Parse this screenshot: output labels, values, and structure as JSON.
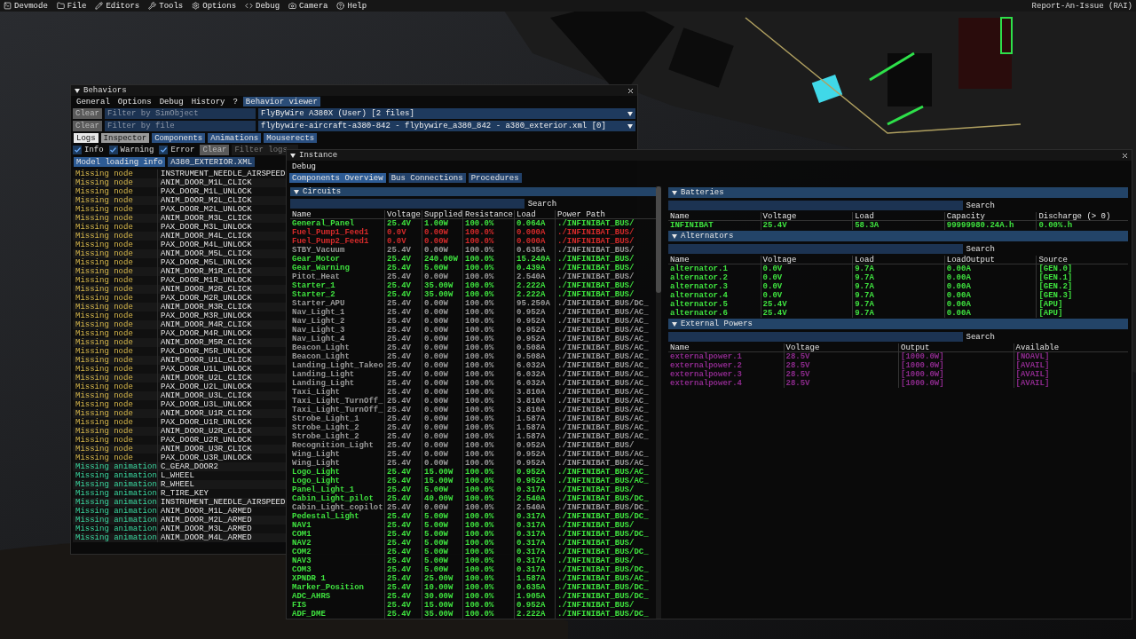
{
  "menu_bar": {
    "items": [
      {
        "label": "Devmode"
      },
      {
        "label": "File"
      },
      {
        "label": "Editors"
      },
      {
        "label": "Tools"
      },
      {
        "label": "Options"
      },
      {
        "label": "Debug"
      },
      {
        "label": "Camera"
      },
      {
        "label": "Help"
      }
    ],
    "right": "Report-An-Issue (RAI)"
  },
  "behaviors": {
    "title": "Behaviors",
    "tabs": [
      {
        "label": "General",
        "selected": false
      },
      {
        "label": "Options",
        "selected": false
      },
      {
        "label": "Debug",
        "selected": false
      },
      {
        "label": "History",
        "selected": false
      },
      {
        "label": "?",
        "selected": false
      },
      {
        "label": "Behavior viewer",
        "selected": true
      }
    ],
    "filters": [
      {
        "button": "Clear",
        "placeholder": "Filter by SimObject",
        "dropdown": "FlyByWire A380X (User) [2 files]"
      },
      {
        "button": "Clear",
        "placeholder": "Filter by file",
        "dropdown": "flybywire-aircraft-a380-842 - flybywire_a380_842 - a380_exterior.xml [0]"
      }
    ],
    "sub_tabs": [
      {
        "label": "Logs",
        "selected": true,
        "hovered": false
      },
      {
        "label": "Inspector",
        "selected": false,
        "hovered": true
      },
      {
        "label": "Components",
        "selected": false,
        "hovered": false
      },
      {
        "label": "Animations",
        "selected": false,
        "hovered": false
      },
      {
        "label": "Mouserects",
        "selected": false,
        "hovered": false
      }
    ],
    "log_filters": [
      {
        "label": "Info",
        "checked": true
      },
      {
        "label": "Warning",
        "checked": true
      },
      {
        "label": "Error",
        "checked": true
      }
    ],
    "clear_button": "Clear",
    "filter_placeholder": "Filter logs",
    "file_tabs": [
      {
        "label": "Model loading info",
        "selected": true
      },
      {
        "label": "A380_EXTERIOR.XML",
        "selected": false
      }
    ],
    "logs": [
      {
        "kind": "node",
        "type": "Missing node",
        "target": "INSTRUMENT_NEEDLE_AIRSPEED"
      },
      {
        "kind": "node",
        "type": "Missing node",
        "target": "ANIM_DOOR_M1L_CLICK"
      },
      {
        "kind": "node",
        "type": "Missing node",
        "target": "PAX_DOOR_M1L_UNLOCK"
      },
      {
        "kind": "node",
        "type": "Missing node",
        "target": "ANIM_DOOR_M2L_CLICK"
      },
      {
        "kind": "node",
        "type": "Missing node",
        "target": "PAX_DOOR_M2L_UNLOCK"
      },
      {
        "kind": "node",
        "type": "Missing node",
        "target": "ANIM_DOOR_M3L_CLICK"
      },
      {
        "kind": "node",
        "type": "Missing node",
        "target": "PAX_DOOR_M3L_UNLOCK"
      },
      {
        "kind": "node",
        "type": "Missing node",
        "target": "ANIM_DOOR_M4L_CLICK"
      },
      {
        "kind": "node",
        "type": "Missing node",
        "target": "PAX_DOOR_M4L_UNLOCK"
      },
      {
        "kind": "node",
        "type": "Missing node",
        "target": "ANIM_DOOR_M5L_CLICK"
      },
      {
        "kind": "node",
        "type": "Missing node",
        "target": "PAX_DOOR_M5L_UNLOCK"
      },
      {
        "kind": "node",
        "type": "Missing node",
        "target": "ANIM_DOOR_M1R_CLICK"
      },
      {
        "kind": "node",
        "type": "Missing node",
        "target": "PAX_DOOR_M1R_UNLOCK"
      },
      {
        "kind": "node",
        "type": "Missing node",
        "target": "ANIM_DOOR_M2R_CLICK"
      },
      {
        "kind": "node",
        "type": "Missing node",
        "target": "PAX_DOOR_M2R_UNLOCK"
      },
      {
        "kind": "node",
        "type": "Missing node",
        "target": "ANIM_DOOR_M3R_CLICK"
      },
      {
        "kind": "node",
        "type": "Missing node",
        "target": "PAX_DOOR_M3R_UNLOCK"
      },
      {
        "kind": "node",
        "type": "Missing node",
        "target": "ANIM_DOOR_M4R_CLICK"
      },
      {
        "kind": "node",
        "type": "Missing node",
        "target": "PAX_DOOR_M4R_UNLOCK"
      },
      {
        "kind": "node",
        "type": "Missing node",
        "target": "ANIM_DOOR_M5R_CLICK"
      },
      {
        "kind": "node",
        "type": "Missing node",
        "target": "PAX_DOOR_M5R_UNLOCK"
      },
      {
        "kind": "node",
        "type": "Missing node",
        "target": "ANIM_DOOR_U1L_CLICK"
      },
      {
        "kind": "node",
        "type": "Missing node",
        "target": "PAX_DOOR_U1L_UNLOCK"
      },
      {
        "kind": "node",
        "type": "Missing node",
        "target": "ANIM_DOOR_U2L_CLICK"
      },
      {
        "kind": "node",
        "type": "Missing node",
        "target": "PAX_DOOR_U2L_UNLOCK"
      },
      {
        "kind": "node",
        "type": "Missing node",
        "target": "ANIM_DOOR_U3L_CLICK"
      },
      {
        "kind": "node",
        "type": "Missing node",
        "target": "PAX_DOOR_U3L_UNLOCK"
      },
      {
        "kind": "node",
        "type": "Missing node",
        "target": "ANIM_DOOR_U1R_CLICK"
      },
      {
        "kind": "node",
        "type": "Missing node",
        "target": "PAX_DOOR_U1R_UNLOCK"
      },
      {
        "kind": "node",
        "type": "Missing node",
        "target": "ANIM_DOOR_U2R_CLICK"
      },
      {
        "kind": "node",
        "type": "Missing node",
        "target": "PAX_DOOR_U2R_UNLOCK"
      },
      {
        "kind": "node",
        "type": "Missing node",
        "target": "ANIM_DOOR_U3R_CLICK"
      },
      {
        "kind": "node",
        "type": "Missing node",
        "target": "PAX_DOOR_U3R_UNLOCK"
      },
      {
        "kind": "animation",
        "type": "Missing animation",
        "target": "C_GEAR_DOOR2"
      },
      {
        "kind": "animation",
        "type": "Missing animation",
        "target": "L_WHEEL"
      },
      {
        "kind": "animation",
        "type": "Missing animation",
        "target": "R_WHEEL"
      },
      {
        "kind": "animation",
        "type": "Missing animation",
        "target": "R_TIRE_KEY"
      },
      {
        "kind": "animation",
        "type": "Missing animation",
        "target": "INSTRUMENT_NEEDLE_AIRSPEED"
      },
      {
        "kind": "animation",
        "type": "Missing animation",
        "target": "ANIM_DOOR_M1L_ARMED"
      },
      {
        "kind": "animation",
        "type": "Missing animation",
        "target": "ANIM_DOOR_M2L_ARMED"
      },
      {
        "kind": "animation",
        "type": "Missing animation",
        "target": "ANIM_DOOR_M3L_ARMED"
      },
      {
        "kind": "animation",
        "type": "Missing animation",
        "target": "ANIM_DOOR_M4L_ARMED"
      }
    ]
  },
  "instance": {
    "title": "Instance",
    "menu": "Debug",
    "tabs": [
      {
        "label": "Components Overview",
        "selected": true
      },
      {
        "label": "Bus Connections",
        "selected": false
      },
      {
        "label": "Procedures",
        "selected": false
      }
    ],
    "circuits": {
      "title": "Circuits",
      "search": "Search",
      "columns": [
        "Name",
        "Voltage",
        "Supplied",
        "Resistance",
        "Load",
        "Power Path"
      ],
      "rows": [
        {
          "color": "#3fe23f",
          "cells": [
            "General_Panel",
            "25.4V",
            "1.00W",
            "100.0%",
            "0.064A",
            "./INFINIBAT_BUS/"
          ]
        },
        {
          "color": "#d42a2a",
          "cells": [
            "Fuel_Pump1_Feed1",
            "0.0V",
            "0.00W",
            "100.0%",
            "0.000A",
            "./INFINIBAT_BUS/"
          ]
        },
        {
          "color": "#d42a2a",
          "cells": [
            "Fuel_Pump2_Feed1",
            "0.0V",
            "0.00W",
            "100.0%",
            "0.000A",
            "./INFINIBAT_BUS/"
          ]
        },
        {
          "color": "#9a9a9a",
          "cells": [
            "STBY_Vacuum",
            "25.4V",
            "0.00W",
            "100.0%",
            "0.635A",
            "./INFINIBAT_BUS/"
          ]
        },
        {
          "color": "#3fe23f",
          "cells": [
            "Gear_Motor",
            "25.4V",
            "240.00W",
            "100.0%",
            "15.240A",
            "./INFINIBAT_BUS/"
          ]
        },
        {
          "color": "#3fe23f",
          "cells": [
            "Gear_Warning",
            "25.4V",
            "5.00W",
            "100.0%",
            "0.439A",
            "./INFINIBAT_BUS/"
          ]
        },
        {
          "color": "#9a9a9a",
          "cells": [
            "Pitot_Heat",
            "25.4V",
            "0.00W",
            "100.0%",
            "2.540A",
            "./INFINIBAT_BUS/"
          ]
        },
        {
          "color": "#3fe23f",
          "cells": [
            "Starter_1",
            "25.4V",
            "35.00W",
            "100.0%",
            "2.222A",
            "./INFINIBAT_BUS/"
          ]
        },
        {
          "color": "#3fe23f",
          "cells": [
            "Starter_2",
            "25.4V",
            "35.00W",
            "100.0%",
            "2.222A",
            "./INFINIBAT_BUS/"
          ]
        },
        {
          "color": "#9a9a9a",
          "cells": [
            "Starter_APU",
            "25.4V",
            "0.00W",
            "100.0%",
            "95.250A",
            "./INFINIBAT_BUS/DC_"
          ]
        },
        {
          "color": "#9a9a9a",
          "cells": [
            "Nav_Light_1",
            "25.4V",
            "0.00W",
            "100.0%",
            "0.952A",
            "./INFINIBAT_BUS/AC_"
          ]
        },
        {
          "color": "#9a9a9a",
          "cells": [
            "Nav_Light_2",
            "25.4V",
            "0.00W",
            "100.0%",
            "0.952A",
            "./INFINIBAT_BUS/AC_"
          ]
        },
        {
          "color": "#9a9a9a",
          "cells": [
            "Nav_Light_3",
            "25.4V",
            "0.00W",
            "100.0%",
            "0.952A",
            "./INFINIBAT_BUS/AC_"
          ]
        },
        {
          "color": "#9a9a9a",
          "cells": [
            "Nav_Light_4",
            "25.4V",
            "0.00W",
            "100.0%",
            "0.952A",
            "./INFINIBAT_BUS/AC_"
          ]
        },
        {
          "color": "#9a9a9a",
          "cells": [
            "Beacon_Light",
            "25.4V",
            "0.00W",
            "100.0%",
            "0.508A",
            "./INFINIBAT_BUS/AC_"
          ]
        },
        {
          "color": "#9a9a9a",
          "cells": [
            "Beacon_Light",
            "25.4V",
            "0.00W",
            "100.0%",
            "0.508A",
            "./INFINIBAT_BUS/AC_"
          ]
        },
        {
          "color": "#9a9a9a",
          "cells": [
            "Landing_Light_Takeo",
            "25.4V",
            "0.00W",
            "100.0%",
            "6.032A",
            "./INFINIBAT_BUS/AC_"
          ]
        },
        {
          "color": "#9a9a9a",
          "cells": [
            "Landing_Light",
            "25.4V",
            "0.00W",
            "100.0%",
            "6.032A",
            "./INFINIBAT_BUS/AC_"
          ]
        },
        {
          "color": "#9a9a9a",
          "cells": [
            "Landing_Light",
            "25.4V",
            "0.00W",
            "100.0%",
            "6.032A",
            "./INFINIBAT_BUS/AC_"
          ]
        },
        {
          "color": "#9a9a9a",
          "cells": [
            "Taxi_Light",
            "25.4V",
            "0.00W",
            "100.0%",
            "3.810A",
            "./INFINIBAT_BUS/AC_"
          ]
        },
        {
          "color": "#9a9a9a",
          "cells": [
            "Taxi_Light_TurnOff_",
            "25.4V",
            "0.00W",
            "100.0%",
            "3.810A",
            "./INFINIBAT_BUS/AC_"
          ]
        },
        {
          "color": "#9a9a9a",
          "cells": [
            "Taxi_Light_TurnOff_",
            "25.4V",
            "0.00W",
            "100.0%",
            "3.810A",
            "./INFINIBAT_BUS/AC_"
          ]
        },
        {
          "color": "#9a9a9a",
          "cells": [
            "Strobe_Light_1",
            "25.4V",
            "0.00W",
            "100.0%",
            "1.587A",
            "./INFINIBAT_BUS/AC_"
          ]
        },
        {
          "color": "#9a9a9a",
          "cells": [
            "Strobe_Light_2",
            "25.4V",
            "0.00W",
            "100.0%",
            "1.587A",
            "./INFINIBAT_BUS/AC_"
          ]
        },
        {
          "color": "#9a9a9a",
          "cells": [
            "Strobe_Light_2",
            "25.4V",
            "0.00W",
            "100.0%",
            "1.587A",
            "./INFINIBAT_BUS/AC_"
          ]
        },
        {
          "color": "#9a9a9a",
          "cells": [
            "Recognition_Light",
            "25.4V",
            "0.00W",
            "100.0%",
            "0.952A",
            "./INFINIBAT_BUS/"
          ]
        },
        {
          "color": "#9a9a9a",
          "cells": [
            "Wing_Light",
            "25.4V",
            "0.00W",
            "100.0%",
            "0.952A",
            "./INFINIBAT_BUS/AC_"
          ]
        },
        {
          "color": "#9a9a9a",
          "cells": [
            "Wing_Light",
            "25.4V",
            "0.00W",
            "100.0%",
            "0.952A",
            "./INFINIBAT_BUS/AC_"
          ]
        },
        {
          "color": "#3fe23f",
          "cells": [
            "Logo_Light",
            "25.4V",
            "15.00W",
            "100.0%",
            "0.952A",
            "./INFINIBAT_BUS/AC_"
          ]
        },
        {
          "color": "#3fe23f",
          "cells": [
            "Logo_Light",
            "25.4V",
            "15.00W",
            "100.0%",
            "0.952A",
            "./INFINIBAT_BUS/AC_"
          ]
        },
        {
          "color": "#3fe23f",
          "cells": [
            "Panel_Light_1",
            "25.4V",
            "5.00W",
            "100.0%",
            "0.317A",
            "./INFINIBAT_BUS/"
          ]
        },
        {
          "color": "#3fe23f",
          "cells": [
            "Cabin_Light_pilot",
            "25.4V",
            "40.00W",
            "100.0%",
            "2.540A",
            "./INFINIBAT_BUS/DC_"
          ]
        },
        {
          "color": "#9a9a9a",
          "cells": [
            "Cabin_Light_copilot",
            "25.4V",
            "0.00W",
            "100.0%",
            "2.540A",
            "./INFINIBAT_BUS/DC_"
          ]
        },
        {
          "color": "#3fe23f",
          "cells": [
            "Pedestal_Light",
            "25.4V",
            "5.00W",
            "100.0%",
            "0.317A",
            "./INFINIBAT_BUS/DC_"
          ]
        },
        {
          "color": "#3fe23f",
          "cells": [
            "NAV1",
            "25.4V",
            "5.00W",
            "100.0%",
            "0.317A",
            "./INFINIBAT_BUS/"
          ]
        },
        {
          "color": "#3fe23f",
          "cells": [
            "COM1",
            "25.4V",
            "5.00W",
            "100.0%",
            "0.317A",
            "./INFINIBAT_BUS/DC_"
          ]
        },
        {
          "color": "#3fe23f",
          "cells": [
            "NAV2",
            "25.4V",
            "5.00W",
            "100.0%",
            "0.317A",
            "./INFINIBAT_BUS/"
          ]
        },
        {
          "color": "#3fe23f",
          "cells": [
            "COM2",
            "25.4V",
            "5.00W",
            "100.0%",
            "0.317A",
            "./INFINIBAT_BUS/DC_"
          ]
        },
        {
          "color": "#3fe23f",
          "cells": [
            "NAV3",
            "25.4V",
            "5.00W",
            "100.0%",
            "0.317A",
            "./INFINIBAT_BUS/"
          ]
        },
        {
          "color": "#3fe23f",
          "cells": [
            "COM3",
            "25.4V",
            "5.00W",
            "100.0%",
            "0.317A",
            "./INFINIBAT_BUS/DC_"
          ]
        },
        {
          "color": "#3fe23f",
          "cells": [
            "XPNDR 1",
            "25.4V",
            "25.00W",
            "100.0%",
            "1.587A",
            "./INFINIBAT_BUS/AC_"
          ]
        },
        {
          "color": "#3fe23f",
          "cells": [
            "Marker_Position",
            "25.4V",
            "10.00W",
            "100.0%",
            "0.635A",
            "./INFINIBAT_BUS/DC_"
          ]
        },
        {
          "color": "#3fe23f",
          "cells": [
            "ADC_AHRS",
            "25.4V",
            "30.00W",
            "100.0%",
            "1.905A",
            "./INFINIBAT_BUS/DC_"
          ]
        },
        {
          "color": "#3fe23f",
          "cells": [
            "FIS",
            "25.4V",
            "15.00W",
            "100.0%",
            "0.952A",
            "./INFINIBAT_BUS/"
          ]
        },
        {
          "color": "#3fe23f",
          "cells": [
            "ADF_DME",
            "25.4V",
            "35.00W",
            "100.0%",
            "2.222A",
            "./INFINIBAT_BUS/DC_"
          ]
        }
      ]
    },
    "panels": [
      {
        "title": "Batteries",
        "search": "Search",
        "columns": [
          "Name",
          "Voltage",
          "Load",
          "Capacity",
          "Discharge (> 0)"
        ],
        "rows": [
          {
            "color": "#3fe23f",
            "cells": [
              "INFINIBAT",
              "25.4V",
              "58.3A",
              "99999980.24A.h",
              "0.00%.h"
            ]
          }
        ]
      },
      {
        "title": "Alternators",
        "search": "Search",
        "columns": [
          "Name",
          "Voltage",
          "Load",
          "LoadOutput",
          "Source"
        ],
        "rows": [
          {
            "color": "#3fe23f",
            "cells": [
              "alternator.1",
              "0.0V",
              "9.7A",
              "0.00A",
              "[GEN.0]"
            ]
          },
          {
            "color": "#3fe23f",
            "cells": [
              "alternator.2",
              "0.0V",
              "9.7A",
              "0.00A",
              "[GEN.1]"
            ]
          },
          {
            "color": "#3fe23f",
            "cells": [
              "alternator.3",
              "0.0V",
              "9.7A",
              "0.00A",
              "[GEN.2]"
            ]
          },
          {
            "color": "#3fe23f",
            "cells": [
              "alternator.4",
              "0.0V",
              "9.7A",
              "0.00A",
              "[GEN.3]"
            ]
          },
          {
            "color": "#3fe23f",
            "cells": [
              "alternator.5",
              "25.4V",
              "9.7A",
              "0.00A",
              "[APU]"
            ]
          },
          {
            "color": "#3fe23f",
            "cells": [
              "alternator.6",
              "25.4V",
              "9.7A",
              "0.00A",
              "[APU]"
            ]
          }
        ]
      },
      {
        "title": "External Powers",
        "search": "Search",
        "columns": [
          "Name",
          "Voltage",
          "Output",
          "Available"
        ],
        "rows": [
          {
            "color": "#8c2a8c",
            "cells": [
              "externalpower.1",
              "28.5V",
              "[1000.0W]",
              "[NOAVL]"
            ]
          },
          {
            "color": "#8c2a8c",
            "cells": [
              "externalpower.2",
              "28.5V",
              "[1000.0W]",
              "[AVAIL]"
            ]
          },
          {
            "color": "#8c2a8c",
            "cells": [
              "externalpower.3",
              "28.5V",
              "[1000.0W]",
              "[AVAIL]"
            ]
          },
          {
            "color": "#8c2a8c",
            "cells": [
              "externalpower.4",
              "28.5V",
              "[1000.0W]",
              "[AVAIL]"
            ]
          }
        ]
      }
    ]
  }
}
